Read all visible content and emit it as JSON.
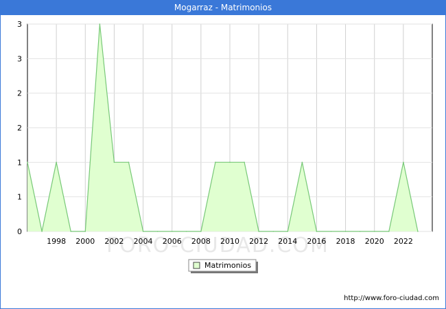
{
  "title": "Mogarraz - Matrimonios",
  "watermark": "FORO-CIUDAD.COM",
  "source": "http://www.foro-ciudad.com",
  "colors": {
    "titlebar": "#3a78d8",
    "fill": "#e0ffd0",
    "line": "#77c877"
  },
  "chart_data": {
    "type": "area",
    "x": [
      1996,
      1997,
      1998,
      1999,
      2000,
      2001,
      2002,
      2003,
      2004,
      2005,
      2006,
      2007,
      2008,
      2009,
      2010,
      2011,
      2012,
      2013,
      2014,
      2015,
      2016,
      2017,
      2018,
      2019,
      2020,
      2021,
      2022,
      2023
    ],
    "series": [
      {
        "name": "Matrimonios",
        "values": [
          1,
          0,
          1,
          0,
          0,
          3,
          1,
          1,
          0,
          0,
          0,
          0,
          0,
          1,
          1,
          1,
          0,
          0,
          0,
          1,
          0,
          0,
          0,
          0,
          0,
          0,
          1,
          0
        ]
      }
    ],
    "xticks": [
      "1998",
      "2000",
      "2002",
      "2004",
      "2006",
      "2008",
      "2010",
      "2012",
      "2014",
      "2016",
      "2018",
      "2020",
      "2022"
    ],
    "yticks": [
      "0",
      "1",
      "1",
      "2",
      "2",
      "3",
      "3"
    ],
    "ylim": [
      0,
      3
    ],
    "grid": true,
    "legend": "bottom-center"
  }
}
